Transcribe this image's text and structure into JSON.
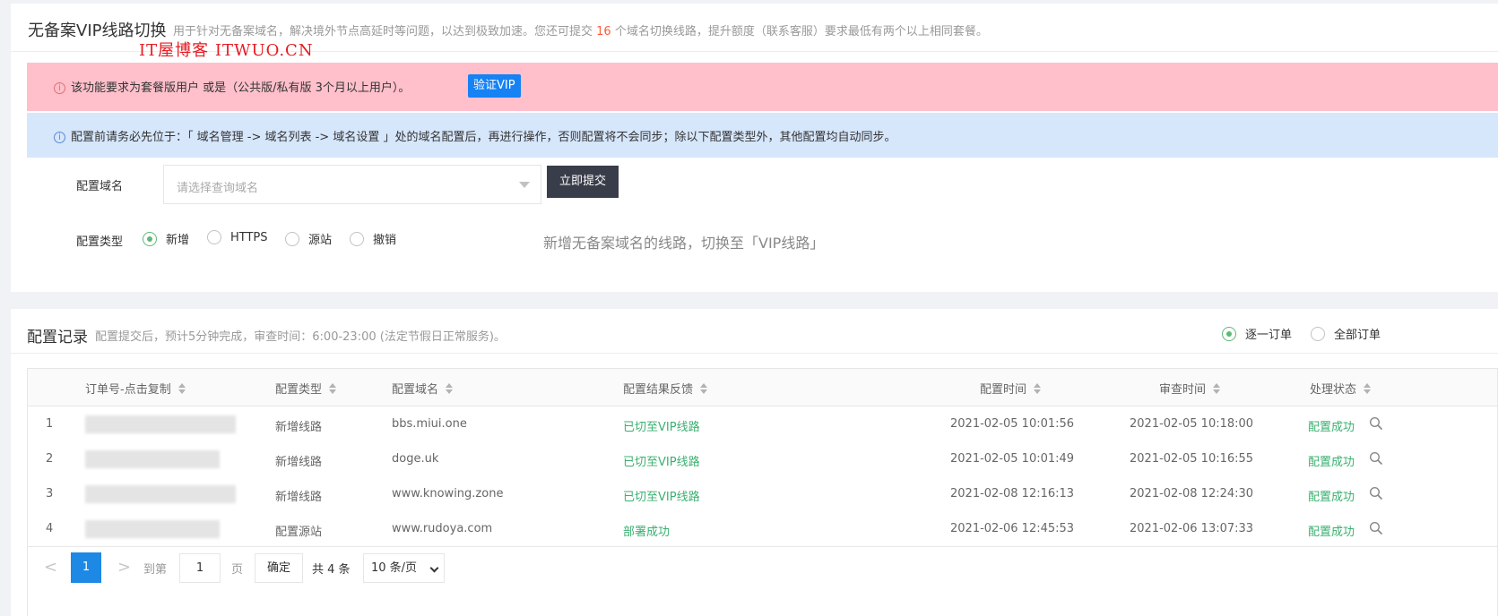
{
  "header": {
    "title": "无备案VIP线路切换",
    "desc_before": "用于针对无备案域名，解决境外节点高延时等问题，以达到极致加速。您还可提交",
    "quota": "16",
    "desc_after": "个域名切换线路，提升额度（联系客服）要求最低有两个以上相同套餐。",
    "watermark": "IT屋博客 ITWUO.CN"
  },
  "alerts": {
    "pink_text": "该功能要求为套餐版用户 或是（公共版/私有版 3个月以上用户）。",
    "verify_btn": "验证VIP",
    "blue_text": "配置前请务必先位于：「 域名管理 -> 域名列表 -> 域名设置 」处的域名配置后，再进行操作，否则配置将不会同步；除以下配置类型外，其他配置均自动同步。",
    "info_glyph": "i"
  },
  "form": {
    "domain_label": "配置域名",
    "domain_placeholder": "请选择查询域名",
    "submit": "立即提交",
    "type_label": "配置类型",
    "types": [
      "新增",
      "HTTPS",
      "源站",
      "撤销"
    ],
    "selected_type": "新增",
    "type_hint": "新增无备案域名的线路，切换至「VIP线路」"
  },
  "records": {
    "title": "配置记录",
    "desc": "配置提交后，预计5分钟完成，审查时间：6:00-23:00 (法定节假日正常服务)。",
    "filter_options": [
      "逐一订单",
      "全部订单"
    ],
    "selected_filter": "逐一订单",
    "columns": [
      "订单号-点击复制",
      "配置类型",
      "配置域名",
      "配置结果反馈",
      "配置时间",
      "审查时间",
      "处理状态"
    ],
    "rows": [
      {
        "idx": "1",
        "type": "新增线路",
        "domain": "bbs.miui.one",
        "result": "已切至VIP线路",
        "config_time": "2021-02-05 10:01:56",
        "review_time": "2021-02-05 10:18:00",
        "status": "配置成功"
      },
      {
        "idx": "2",
        "type": "新增线路",
        "domain": "doge.uk",
        "result": "已切至VIP线路",
        "config_time": "2021-02-05 10:01:49",
        "review_time": "2021-02-05 10:16:55",
        "status": "配置成功"
      },
      {
        "idx": "3",
        "type": "新增线路",
        "domain": "www.knowing.zone",
        "result": "已切至VIP线路",
        "config_time": "2021-02-08 12:16:13",
        "review_time": "2021-02-08 12:24:30",
        "status": "配置成功"
      },
      {
        "idx": "4",
        "type": "配置源站",
        "domain": "www.rudoya.com",
        "result": "部署成功",
        "config_time": "2021-02-06 12:45:53",
        "review_time": "2021-02-06 13:07:33",
        "status": "配置成功"
      }
    ],
    "status_icon": "magnifier-icon"
  },
  "pagination": {
    "prev": "<",
    "next": ">",
    "current": "1",
    "goto_label": "到第",
    "goto_value": "1",
    "page_unit": "页",
    "confirm": "确定",
    "total": "共 4 条",
    "page_size": "10 条/页"
  },
  "colors": {
    "accent_green": "#5fb878",
    "success_text": "#3ab070",
    "pink_alert": "#ffc0cb",
    "blue_alert": "#d6e6fb",
    "primary_blue": "#1682f4",
    "dark_button": "#393d49",
    "quota_red": "#ff5a3c"
  }
}
